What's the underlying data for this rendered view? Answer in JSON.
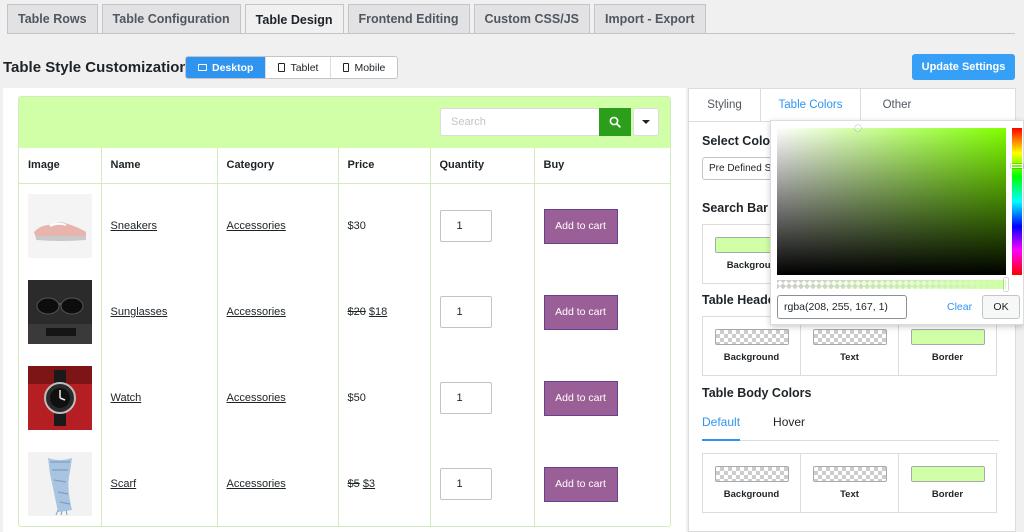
{
  "top_tabs": [
    {
      "label": "Table Rows"
    },
    {
      "label": "Table Configuration"
    },
    {
      "label": "Table Design"
    },
    {
      "label": "Frontend Editing"
    },
    {
      "label": "Custom CSS/JS"
    },
    {
      "label": "Import - Export"
    }
  ],
  "active_tab": "Table Design",
  "header": {
    "title": "Table Style Customization",
    "devices": [
      {
        "label": "Desktop",
        "icon": "desktop-icon"
      },
      {
        "label": "Tablet",
        "icon": "tablet-icon"
      },
      {
        "label": "Mobile",
        "icon": "mobile-icon"
      }
    ],
    "active_device": "Desktop",
    "update_button": "Update Settings"
  },
  "preview": {
    "search_placeholder": "Search",
    "search_icon": "search-icon",
    "columns": [
      "Image",
      "Name",
      "Category",
      "Price",
      "Quantity",
      "Buy"
    ],
    "rows": [
      {
        "name": "Sneakers",
        "category": "Accessories",
        "price_old": "",
        "price": "$30",
        "qty": "1",
        "buy": "Add to cart",
        "image": "sneakers"
      },
      {
        "name": "Sunglasses",
        "category": "Accessories",
        "price_old": "$20",
        "price": "$18",
        "qty": "1",
        "buy": "Add to cart",
        "image": "sunglasses"
      },
      {
        "name": "Watch",
        "category": "Accessories",
        "price_old": "",
        "price": "$50",
        "qty": "1",
        "buy": "Add to cart",
        "image": "watch"
      },
      {
        "name": "Scarf",
        "category": "Accessories",
        "price_old": "$5",
        "price": "$3",
        "qty": "1",
        "buy": "Add to cart",
        "image": "scarf"
      }
    ],
    "colors": {
      "search_bar_bg": "#d0ffa7",
      "search_button": "#2c9e1c",
      "cart_button": "#9b5f97",
      "cart_border": "#66438f"
    }
  },
  "side": {
    "tabs": [
      "Styling",
      "Table Colors",
      "Other"
    ],
    "active_tab": "Table Colors",
    "select_color_title": "Select Colo",
    "select_value": "Pre Defined S",
    "search_bar_title": "Search Bar C",
    "search_bar_swatch_label": "Backgroun",
    "table_header_title": "Table Heade",
    "header_swatches": [
      "Background",
      "Text",
      "Border"
    ],
    "table_body_title": "Table Body Colors",
    "body_subtabs": [
      "Default",
      "Hover"
    ],
    "active_subtab": "Default",
    "body_swatches": [
      "Background",
      "Text",
      "Border"
    ]
  },
  "picker": {
    "value": "rgba(208, 255, 167, 1)",
    "clear": "Clear",
    "ok": "OK"
  }
}
